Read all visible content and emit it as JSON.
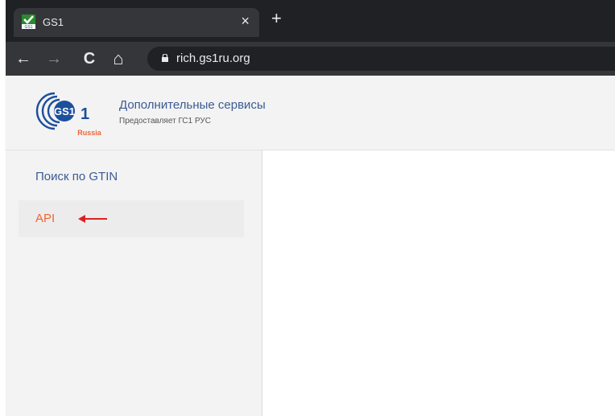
{
  "browser": {
    "tab": {
      "title": "GS1",
      "close": "×"
    },
    "new_tab": "+",
    "nav": {
      "back": "←",
      "forward": "→",
      "reload": "C",
      "home": "⌂"
    },
    "url": "rich.gs1ru.org",
    "colors": {
      "tabbar": "#202124",
      "toolbar": "#35363a"
    }
  },
  "header": {
    "logo_icon": "gs1-russia-logo",
    "logo_text": "GS1",
    "logo_sub": "Russia",
    "title": "Дополнительные сервисы",
    "subtitle": "Предоставляет ГС1 РУС"
  },
  "sidebar": {
    "items": [
      {
        "label": "Поиск по GTIN"
      },
      {
        "label": "API",
        "active": true
      }
    ]
  },
  "annotation": {
    "icon": "red-arrow-left",
    "color": "#e02020"
  },
  "colors": {
    "link": "#3b5b93",
    "active": "#f26334",
    "logo_blue": "#1c4f9c"
  }
}
